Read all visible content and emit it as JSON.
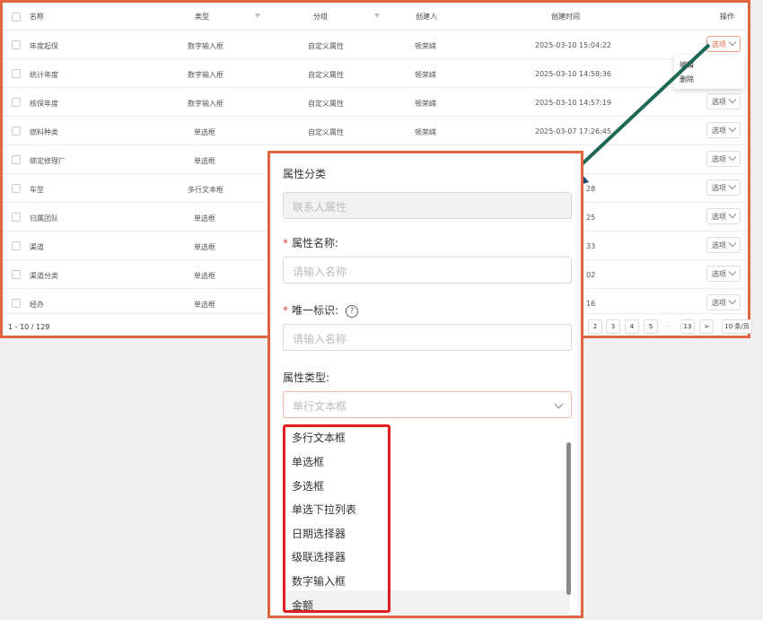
{
  "table": {
    "headers": {
      "name": "名称",
      "type": "类型",
      "group": "分组",
      "creator": "创建人",
      "created": "创建时间",
      "action": "操作"
    },
    "rows": [
      {
        "name": "年度起保",
        "type": "数字输入框",
        "group": "自定义属性",
        "creator": "顿荣嵘",
        "created": "2025-03-10 15:04:22",
        "action": "选项"
      },
      {
        "name": "统计年度",
        "type": "数字输入框",
        "group": "自定义属性",
        "creator": "顿荣嵘",
        "created": "2025-03-10 14:58:36",
        "action": "选项"
      },
      {
        "name": "核保年度",
        "type": "数字输入框",
        "group": "自定义属性",
        "creator": "顿荣嵘",
        "created": "2025-03-10 14:57:19",
        "action": "选项"
      },
      {
        "name": "燃料种类",
        "type": "单选框",
        "group": "自定义属性",
        "creator": "顿荣嵘",
        "created": "2025-03-07 17:26:45",
        "action": "选项"
      },
      {
        "name": "绑定修理厂",
        "type": "单选框",
        "group": "",
        "creator": "",
        "created": "",
        "action": "选项"
      },
      {
        "name": "车型",
        "type": "多行文本框",
        "group": "",
        "creator": "",
        "created": "28",
        "action": "选项"
      },
      {
        "name": "归属团队",
        "type": "单选框",
        "group": "",
        "creator": "",
        "created": "25",
        "action": "选项"
      },
      {
        "name": "渠道",
        "type": "单选框",
        "group": "",
        "creator": "",
        "created": "33",
        "action": "选项"
      },
      {
        "name": "渠道分类",
        "type": "单选框",
        "group": "",
        "creator": "",
        "created": "02",
        "action": "选项"
      },
      {
        "name": "经办",
        "type": "单选框",
        "group": "",
        "creator": "",
        "created": "16",
        "action": "选项"
      }
    ]
  },
  "row_menu": {
    "items": [
      "编辑",
      "删除"
    ]
  },
  "footer": {
    "range": "1 - 10 / 129",
    "pages": [
      "2",
      "3",
      "4",
      "5",
      "···",
      "13",
      ">"
    ],
    "page_size": "10 条/页"
  },
  "form": {
    "category_label": "属性分类",
    "category_value": "联系人属性",
    "name_label": "属性名称:",
    "name_placeholder": "请输入名称",
    "key_label": "唯一标识:",
    "key_help": "?",
    "key_placeholder": "请输入名称",
    "type_label": "属性类型:",
    "type_value": "单行文本框",
    "required_mark": "*",
    "options": [
      "多行文本框",
      "单选框",
      "多选框",
      "单选下拉列表",
      "日期选择器",
      "级联选择器",
      "数字输入框",
      "金额"
    ]
  },
  "colors": {
    "accent": "#e0653f",
    "highlight": "#e01e1e",
    "arrow": "#1e6655"
  }
}
